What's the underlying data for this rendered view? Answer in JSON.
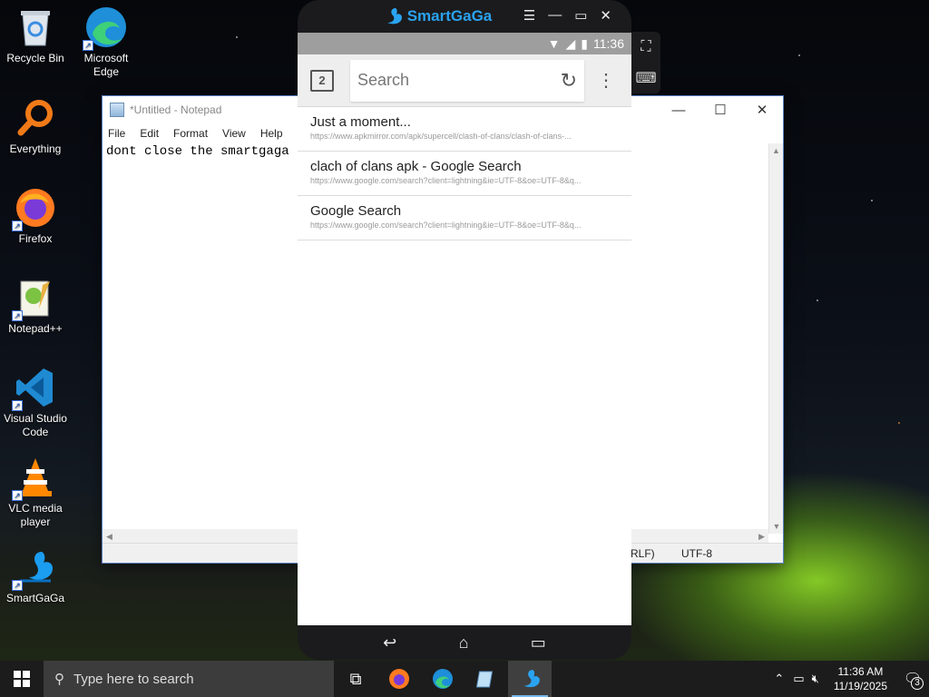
{
  "desktop": {
    "icons": [
      {
        "label": "Recycle Bin",
        "icon": "recycle-bin-icon"
      },
      {
        "label": "Microsoft Edge",
        "icon": "edge-icon"
      },
      {
        "label": "Everything",
        "icon": "everything-icon"
      },
      {
        "label": "Firefox",
        "icon": "firefox-icon"
      },
      {
        "label": "Notepad++",
        "icon": "notepad-plus-plus-icon"
      },
      {
        "label": "Visual Studio Code",
        "icon": "vscode-icon"
      },
      {
        "label": "VLC media player",
        "icon": "vlc-icon"
      },
      {
        "label": "SmartGaGa",
        "icon": "smartgaga-icon"
      }
    ]
  },
  "notepad": {
    "title": "*Untitled - Notepad",
    "menu": [
      "File",
      "Edit",
      "Format",
      "View",
      "Help"
    ],
    "content": "dont close the smartgaga (b",
    "status": {
      "line_ending": "RLF)",
      "encoding": "UTF-8"
    }
  },
  "smartgaga": {
    "brand": "SmartGaGa",
    "status_time": "11:36",
    "tab_count": "2",
    "search_placeholder": "Search",
    "suggestions": [
      {
        "title": "Just a moment...",
        "url": "https://www.apkmirror.com/apk/supercell/clash-of-clans/clash-of-clans-..."
      },
      {
        "title": "clach of clans apk - Google Search",
        "url": "https://www.google.com/search?client=lightning&ie=UTF-8&oe=UTF-8&q..."
      },
      {
        "title": "Google Search",
        "url": "https://www.google.com/search?client=lightning&ie=UTF-8&oe=UTF-8&q..."
      }
    ]
  },
  "taskbar": {
    "search_placeholder": "Type here to search",
    "clock_time": "11:36 AM",
    "clock_date": "11/19/2025",
    "notification_count": "3"
  }
}
